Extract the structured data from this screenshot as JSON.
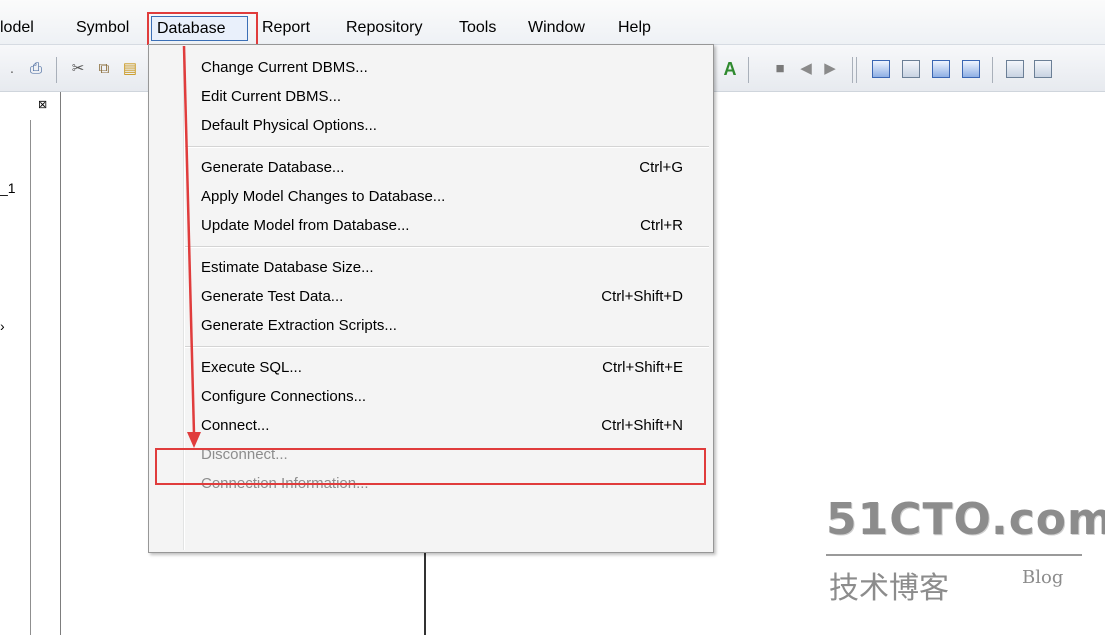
{
  "menubar": {
    "items": [
      "lodel",
      "Symbol",
      "Database",
      "Report",
      "Repository",
      "Tools",
      "Window",
      "Help"
    ]
  },
  "left_panel": {
    "items": [
      "_1"
    ]
  },
  "database_menu": {
    "groups": [
      [
        {
          "label": "Change Current DBMS...",
          "shortcut": ""
        },
        {
          "label": "Edit Current DBMS...",
          "shortcut": ""
        },
        {
          "label": "Default Physical Options...",
          "shortcut": ""
        }
      ],
      [
        {
          "label": "Generate Database...",
          "shortcut": "Ctrl+G"
        },
        {
          "label": "Apply Model Changes to Database...",
          "shortcut": ""
        },
        {
          "label": "Update Model from Database...",
          "shortcut": "Ctrl+R"
        }
      ],
      [
        {
          "label": "Estimate Database Size...",
          "shortcut": ""
        },
        {
          "label": "Generate Test Data...",
          "shortcut": "Ctrl+Shift+D"
        },
        {
          "label": "Generate Extraction Scripts...",
          "shortcut": ""
        }
      ],
      [
        {
          "label": "Execute SQL...",
          "shortcut": "Ctrl+Shift+E"
        },
        {
          "label": "Configure Connections...",
          "shortcut": ""
        },
        {
          "label": "Connect...",
          "shortcut": "Ctrl+Shift+N"
        },
        {
          "label": "Disconnect...",
          "shortcut": "",
          "disabled": true
        },
        {
          "label": "Connection Information...",
          "shortcut": "",
          "disabled": true
        }
      ]
    ]
  },
  "highlight_color": "#e03c3c",
  "watermark": {
    "main": "51CTO.com",
    "sub": "技术博客",
    "blog": "Blog"
  }
}
